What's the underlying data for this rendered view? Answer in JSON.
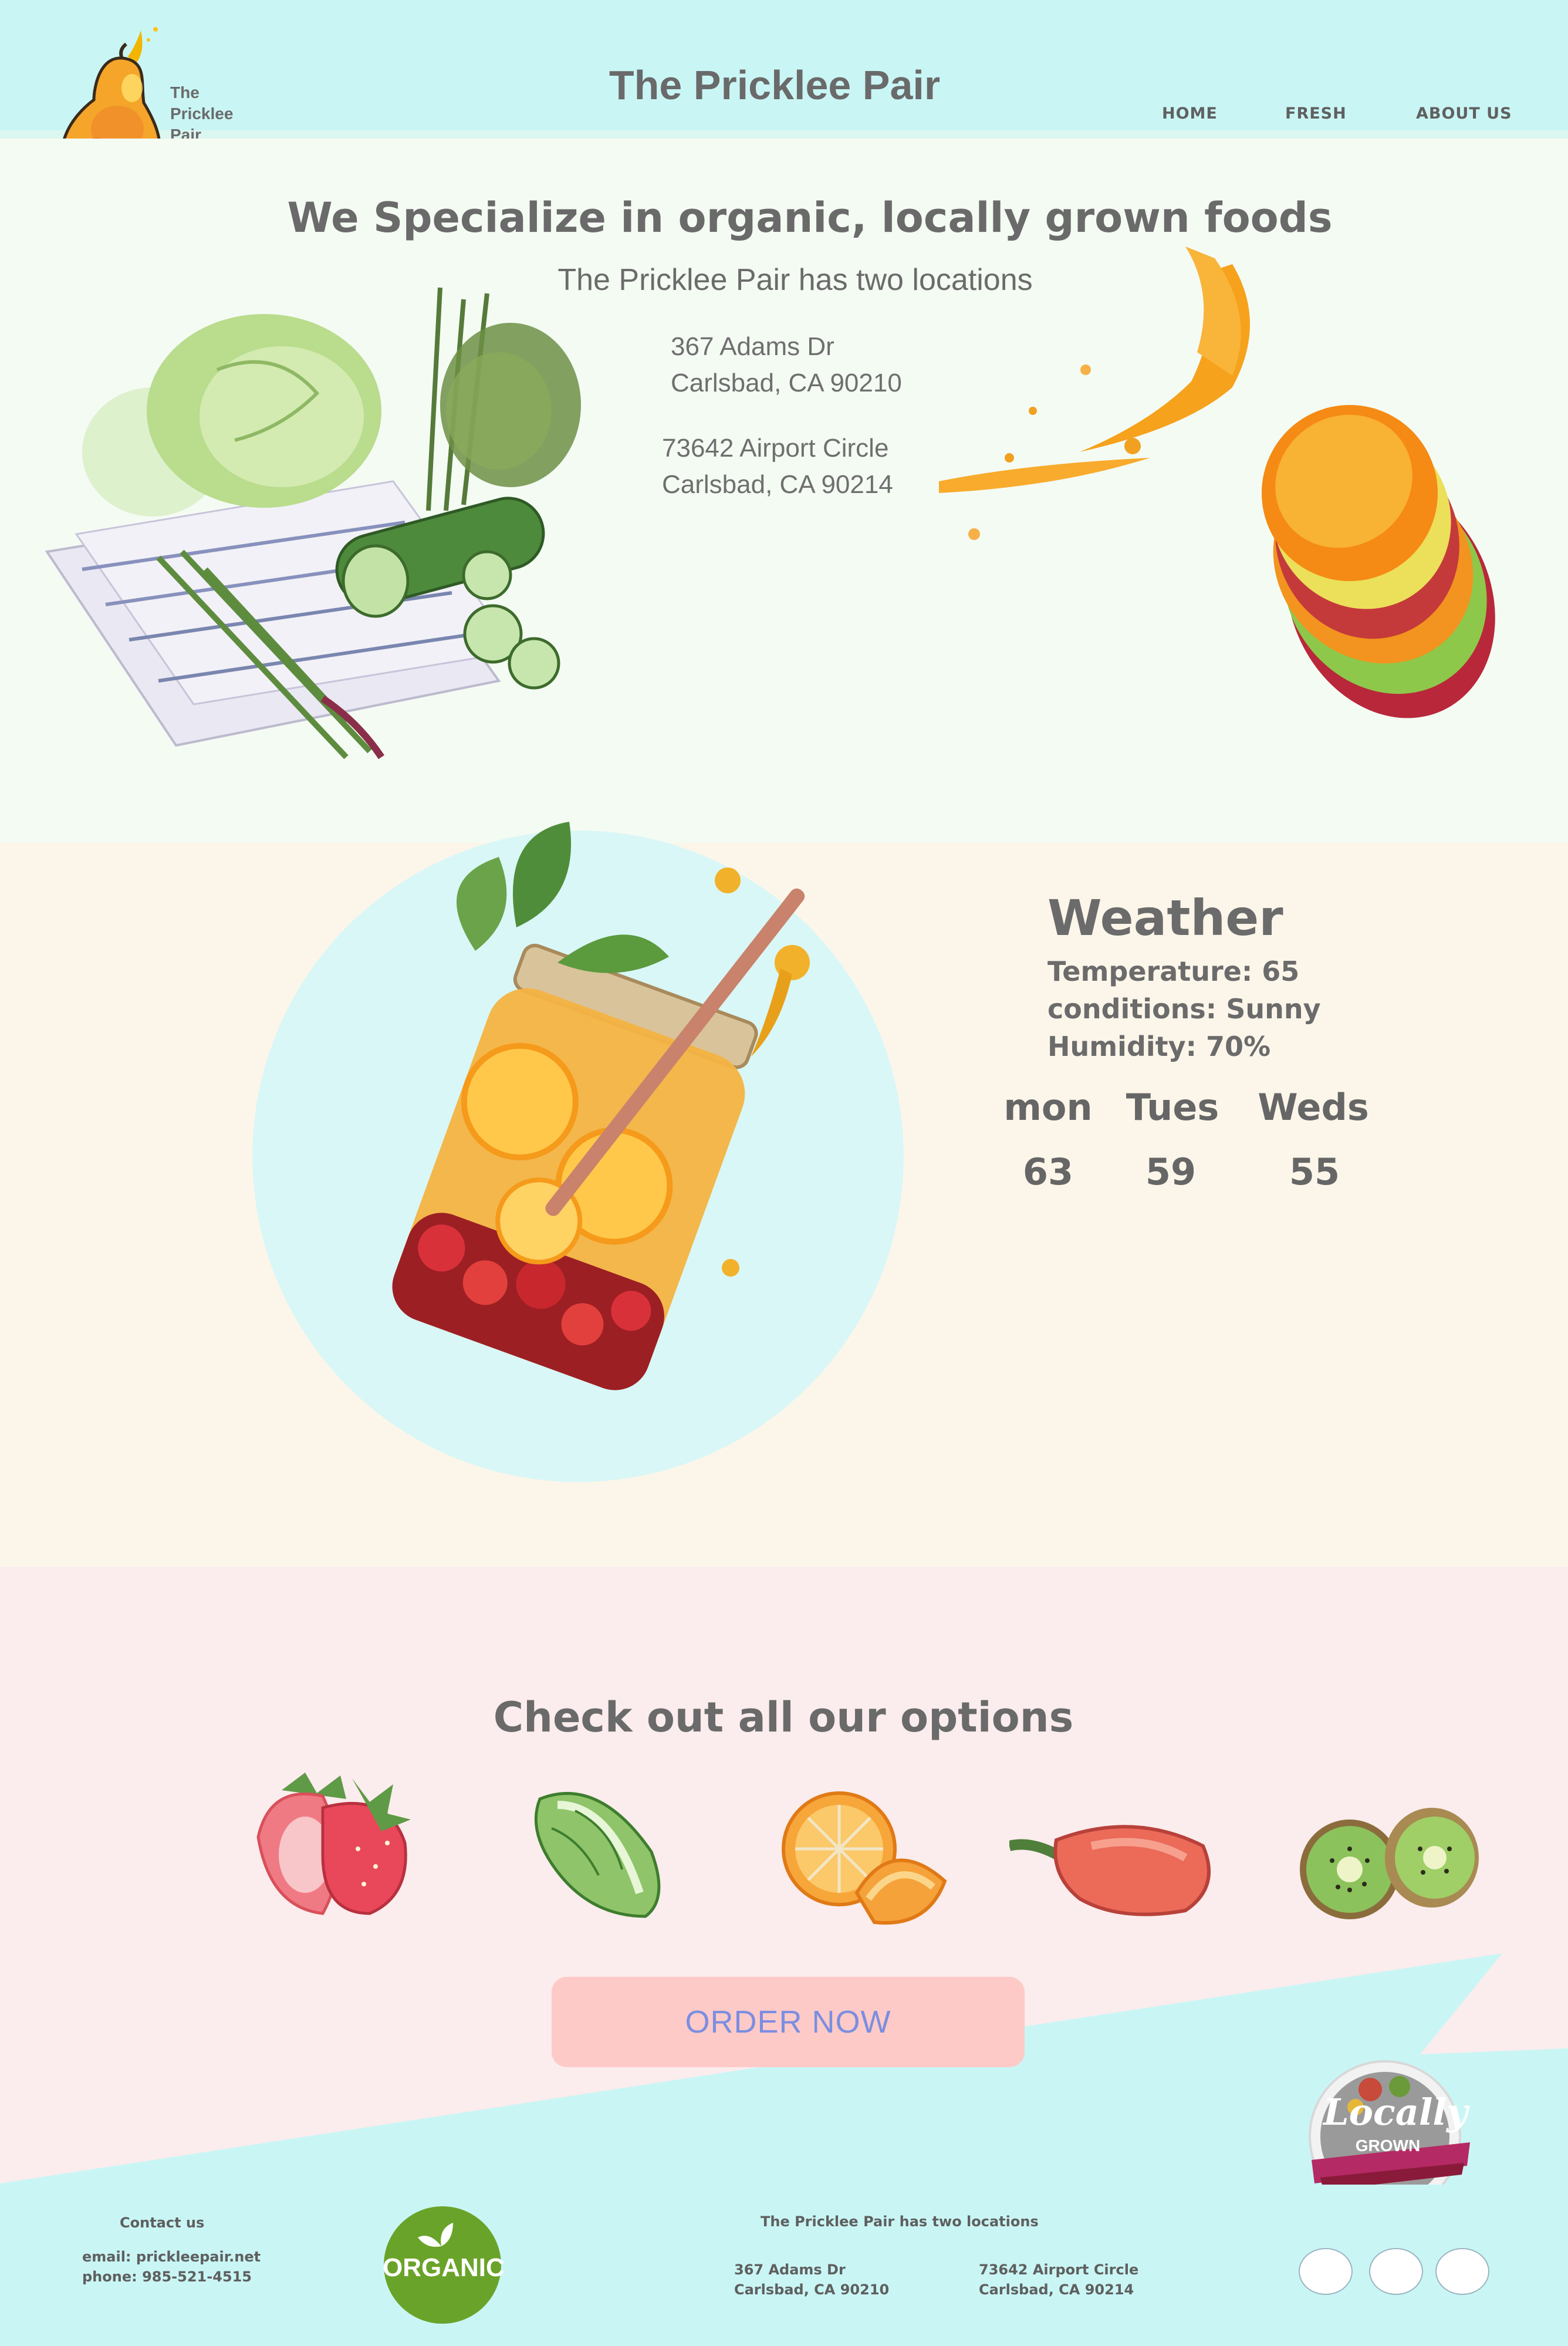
{
  "header": {
    "brand_title": "The Pricklee Pair",
    "logo_text": "The\nPricklee\n Pair",
    "nav": [
      {
        "label": "HOME"
      },
      {
        "label": "FRESH"
      },
      {
        "label": "ABOUT US"
      }
    ]
  },
  "hero": {
    "heading": "We Specialize in organic, locally grown foods",
    "subheading": "The Pricklee Pair has two locations",
    "locations": [
      {
        "street": "367 Adams Dr",
        "city": "Carlsbad, CA 90210"
      },
      {
        "street": "73642 Airport Circle",
        "city": "Carlsbad, CA 90214"
      }
    ]
  },
  "weather": {
    "title": "Weather",
    "temperature": "Temperature: 65",
    "conditions": "conditions: Sunny",
    "humidity": "Humidity:  70%",
    "forecast": [
      {
        "day": "mon",
        "temp": "63"
      },
      {
        "day": "Tues",
        "temp": "59"
      },
      {
        "day": "Weds",
        "temp": "55"
      }
    ]
  },
  "options": {
    "title": "Check out all our options",
    "items": [
      "strawberry-image",
      "lettuce-image",
      "orange-image",
      "pepper-image",
      "kiwi-image"
    ],
    "order_button": "ORDER NOW"
  },
  "badges": {
    "organic": "ORGANIC",
    "locally_line1": "Locally",
    "locally_line2": "GROWN"
  },
  "footer": {
    "contact_heading": "Contact us",
    "email": "email: prickleepair.net",
    "phone": "phone: 985-521-4515",
    "locations_heading": "The Pricklee Pair has two locations",
    "locations": [
      {
        "street": "367 Adams Dr",
        "city": "Carlsbad, CA 90210"
      },
      {
        "street": "73642 Airport Circle",
        "city": "Carlsbad, CA 90214"
      }
    ]
  },
  "colors": {
    "header_bg": "#c9f6f5",
    "hero_bg": "#f4fbf3",
    "weather_bg": "#fcf6ea",
    "options_bg": "#fbeced",
    "button_bg": "#fecac8",
    "button_text": "#7b8ee0",
    "organic_green": "#6aa329"
  }
}
